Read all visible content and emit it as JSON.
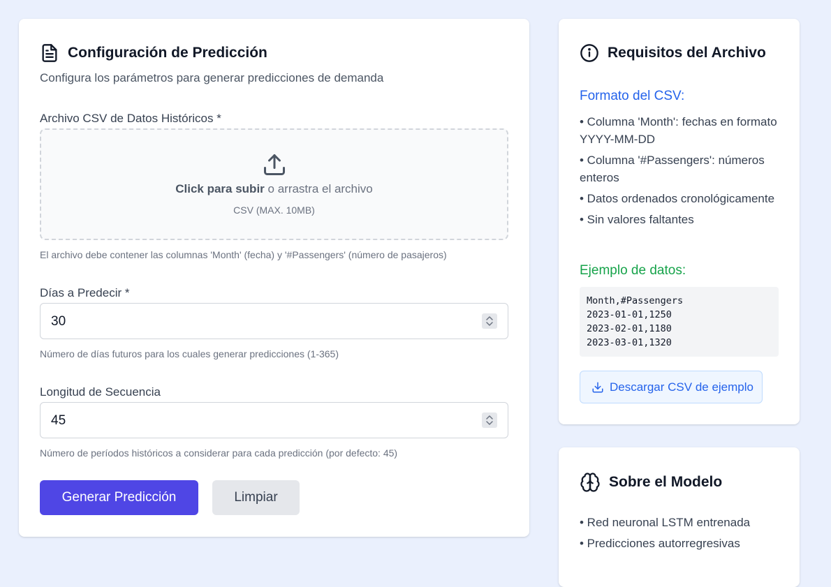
{
  "config": {
    "title": "Configuración de Predicción",
    "description": "Configura los parámetros para generar predicciones de demanda",
    "file": {
      "label": "Archivo CSV de Datos Históricos *",
      "upload_bold": "Click para subir",
      "upload_rest": " o arrastra el archivo",
      "upload_hint": "CSV (MAX. 10MB)",
      "help": "El archivo debe contener las columnas 'Month' (fecha) y '#Passengers' (número de pasajeros)"
    },
    "days": {
      "label": "Días a Predecir *",
      "value": "30",
      "help": "Número de días futuros para los cuales generar predicciones (1-365)"
    },
    "sequence": {
      "label": "Longitud de Secuencia",
      "value": "45",
      "help": "Número de períodos históricos a considerar para cada predicción (por defecto: 45)"
    },
    "buttons": {
      "generate": "Generar Predicción",
      "clear": "Limpiar"
    }
  },
  "requirements": {
    "title": "Requisitos del Archivo",
    "format_heading": "Formato del CSV:",
    "format_items": [
      "• Columna 'Month': fechas en formato YYYY-MM-DD",
      "• Columna '#Passengers': números enteros",
      "• Datos ordenados cronológicamente",
      "• Sin valores faltantes"
    ],
    "example_heading": "Ejemplo de datos:",
    "example_lines": [
      "Month,#Passengers",
      "2023-01-01,1250",
      "2023-02-01,1180",
      "2023-03-01,1320"
    ],
    "download_label": "Descargar CSV de ejemplo"
  },
  "model": {
    "title": "Sobre el Modelo",
    "items": [
      "• Red neuronal LSTM entrenada",
      "• Predicciones autorregresivas"
    ]
  },
  "colors": {
    "primary": "#4f46e5",
    "link_blue": "#2563eb",
    "green": "#16a34a",
    "background": "#eaf0fd"
  }
}
